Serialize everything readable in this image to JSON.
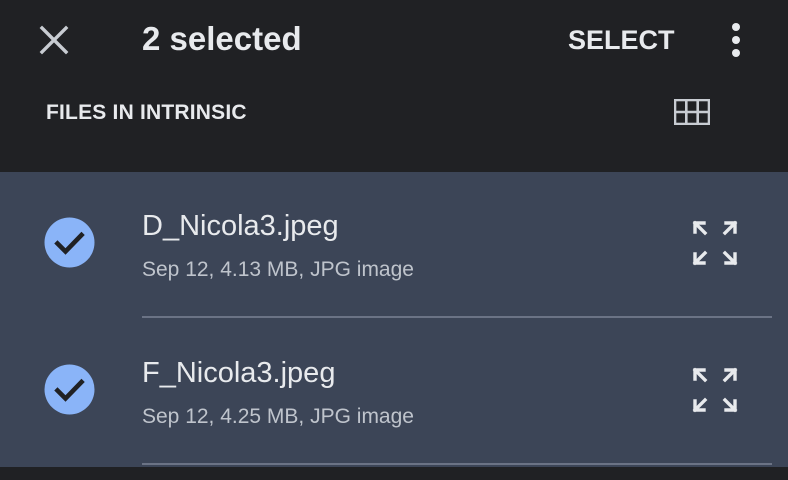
{
  "appbar": {
    "close_icon": "close-icon",
    "title": "2 selected",
    "select_label": "SELECT",
    "more_icon": "more-vert-icon"
  },
  "section": {
    "title": "FILES IN INTRINSIC",
    "view_icon": "grid-view-icon"
  },
  "files": [
    {
      "name": "D_Nicola3.jpeg",
      "meta": "Sep 12, 4.13 MB, JPG image",
      "selected": true
    },
    {
      "name": "F_Nicola3.jpeg",
      "meta": "Sep 12, 4.25 MB, JPG image",
      "selected": true
    }
  ],
  "colors": {
    "background": "#202124",
    "selected_row": "#3c4557",
    "check_fill": "#8ab4f8",
    "text_primary": "#e8eaed",
    "text_secondary": "#bfc4cc"
  }
}
